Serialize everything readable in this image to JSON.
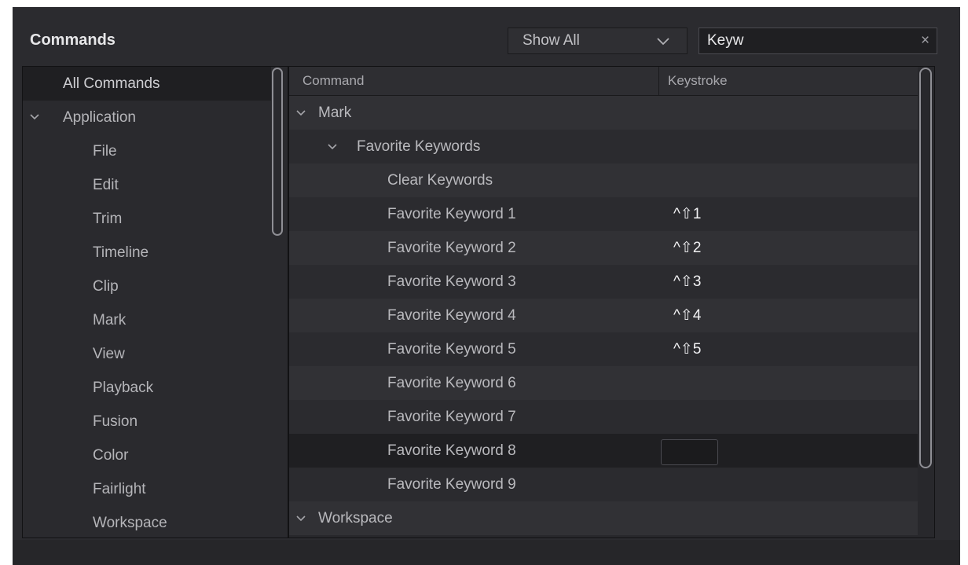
{
  "header": {
    "title": "Commands",
    "filter": {
      "selected": "Show All"
    },
    "search": {
      "value": "Keyw",
      "clear_glyph": "×"
    }
  },
  "sidebar": {
    "items": [
      {
        "label": "All Commands",
        "selected": true
      },
      {
        "label": "Application",
        "expandable": true
      },
      {
        "label": "File"
      },
      {
        "label": "Edit"
      },
      {
        "label": "Trim"
      },
      {
        "label": "Timeline"
      },
      {
        "label": "Clip"
      },
      {
        "label": "Mark"
      },
      {
        "label": "View"
      },
      {
        "label": "Playback"
      },
      {
        "label": "Fusion"
      },
      {
        "label": "Color"
      },
      {
        "label": "Fairlight"
      },
      {
        "label": "Workspace"
      }
    ]
  },
  "table": {
    "columns": {
      "command": "Command",
      "keystroke": "Keystroke"
    },
    "rows": [
      {
        "command": "Mark",
        "keystroke": "",
        "expandable": true
      },
      {
        "command": "Favorite Keywords",
        "keystroke": "",
        "expandable": true
      },
      {
        "command": "Clear Keywords",
        "keystroke": ""
      },
      {
        "command": "Favorite Keyword 1",
        "keystroke": "^⇧1"
      },
      {
        "command": "Favorite Keyword 2",
        "keystroke": "^⇧2"
      },
      {
        "command": "Favorite Keyword 3",
        "keystroke": "^⇧3"
      },
      {
        "command": "Favorite Keyword 4",
        "keystroke": "^⇧4"
      },
      {
        "command": "Favorite Keyword 5",
        "keystroke": "^⇧5"
      },
      {
        "command": "Favorite Keyword 6",
        "keystroke": ""
      },
      {
        "command": "Favorite Keyword 7",
        "keystroke": ""
      },
      {
        "command": "Favorite Keyword 8",
        "keystroke": "",
        "selected": true,
        "editing": true
      },
      {
        "command": "Favorite Keyword 9",
        "keystroke": ""
      },
      {
        "command": "Workspace",
        "keystroke": "",
        "expandable": true
      }
    ]
  },
  "colors": {
    "background": "#2b2b2f",
    "selected_row": "#1f1f22",
    "text": "#b9b9bd",
    "title": "#e6e6e8"
  }
}
